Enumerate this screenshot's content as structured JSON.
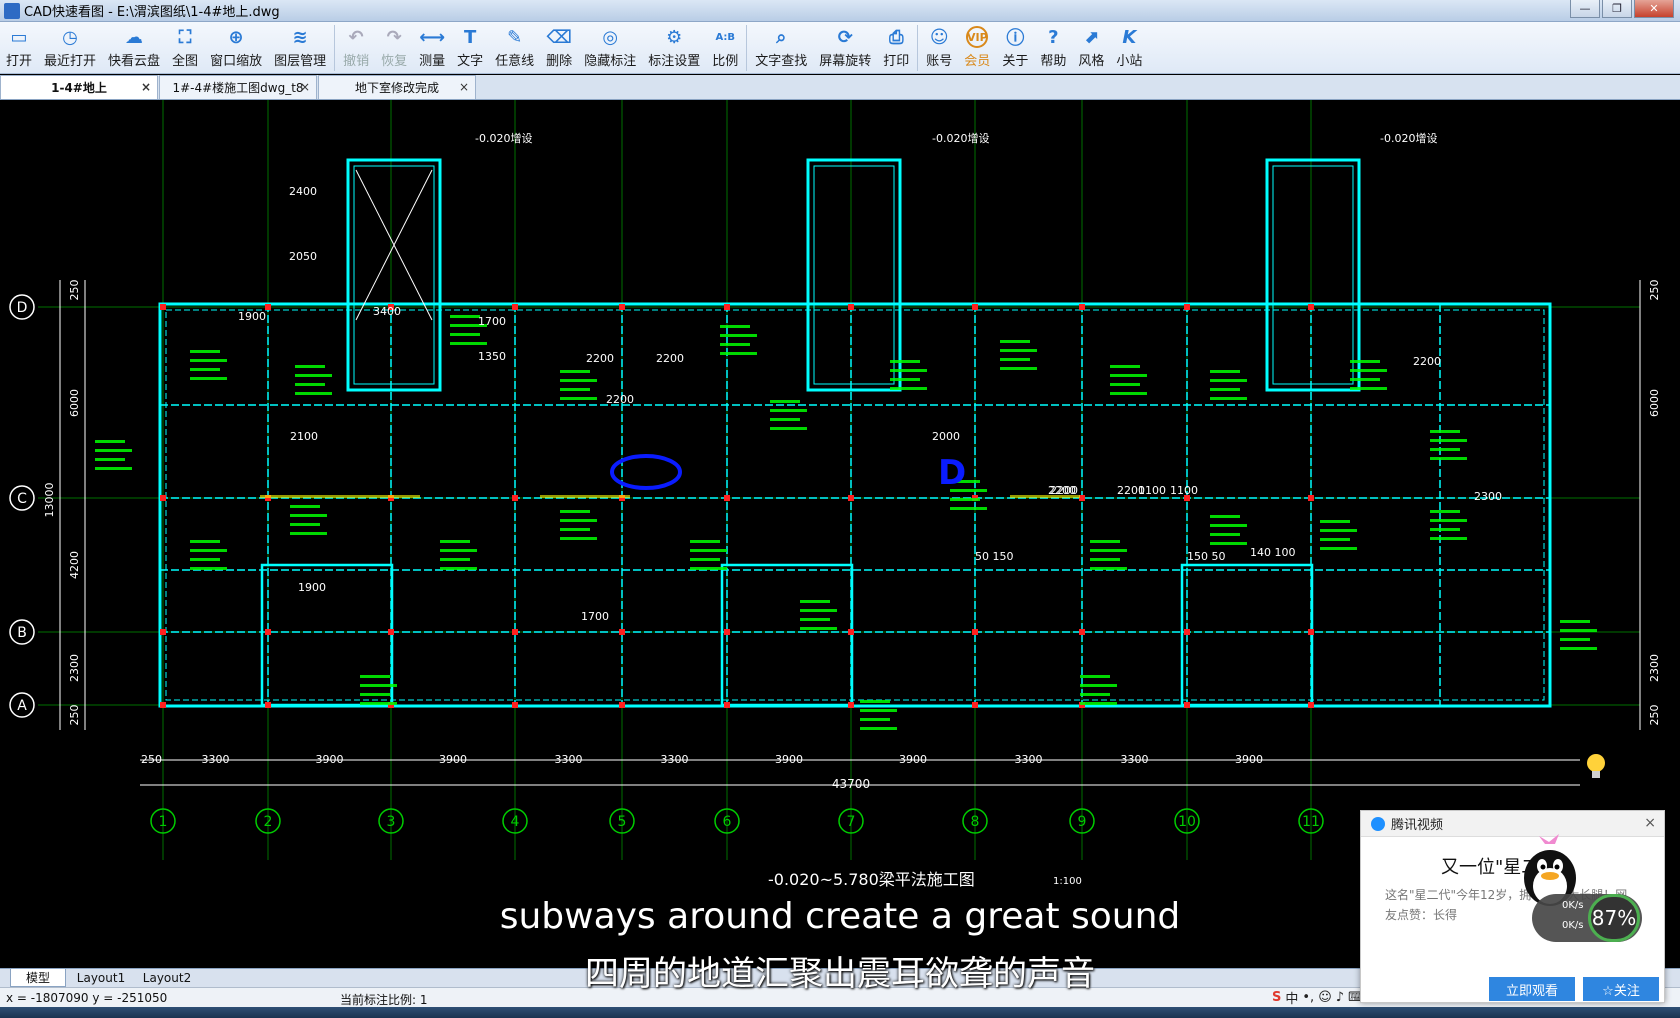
{
  "window": {
    "title": "CAD快速看图 - E:\\渭滨图纸\\1-4#地上.dwg",
    "buttons": [
      "—",
      "❐",
      "✕"
    ]
  },
  "toolbar": {
    "items": [
      {
        "label": "打开",
        "icon": "folder-open-icon"
      },
      {
        "label": "最近打开",
        "icon": "history-icon"
      },
      {
        "label": "快看云盘",
        "icon": "cloud-icon"
      },
      {
        "label": "全图",
        "icon": "fit-all-icon"
      },
      {
        "label": "窗口缩放",
        "icon": "zoom-window-icon"
      },
      {
        "label": "图层管理",
        "icon": "layers-icon"
      },
      {
        "label": "撤销",
        "icon": "undo-icon"
      },
      {
        "label": "恢复",
        "icon": "redo-icon"
      },
      {
        "label": "测量",
        "icon": "measure-icon"
      },
      {
        "label": "文字",
        "icon": "text-icon"
      },
      {
        "label": "任意线",
        "icon": "pen-icon"
      },
      {
        "label": "删除",
        "icon": "eraser-icon"
      },
      {
        "label": "隐藏标注",
        "icon": "eye-hide-icon"
      },
      {
        "label": "标注设置",
        "icon": "annotation-settings-icon"
      },
      {
        "label": "比例",
        "icon": "scale-icon"
      },
      {
        "label": "文字查找",
        "icon": "text-search-icon"
      },
      {
        "label": "屏幕旋转",
        "icon": "rotate-screen-icon"
      },
      {
        "label": "打印",
        "icon": "print-icon"
      },
      {
        "label": "账号",
        "icon": "user-icon"
      },
      {
        "label": "会员",
        "icon": "vip-icon"
      },
      {
        "label": "关于",
        "icon": "info-icon"
      },
      {
        "label": "帮助",
        "icon": "help-icon"
      },
      {
        "label": "风格",
        "icon": "style-icon"
      },
      {
        "label": "小站",
        "icon": "site-icon"
      }
    ]
  },
  "tabs": [
    {
      "label": "1-4#地上",
      "close": "×"
    },
    {
      "label": "1#-4#楼施工图dwg_t8",
      "close": "×"
    },
    {
      "label": "地下室修改完成",
      "close": "×"
    }
  ],
  "drawing": {
    "axis_rows": [
      "D",
      "C",
      "B",
      "A"
    ],
    "axis_cols": [
      "1",
      "2",
      "3",
      "4",
      "5",
      "6",
      "7",
      "8",
      "9",
      "10",
      "11"
    ],
    "bay_dims": [
      "250",
      "3300",
      "3900",
      "3900",
      "3300",
      "3300",
      "3900",
      "3900",
      "3300",
      "3300",
      "3900"
    ],
    "total_dim": "43700",
    "left_dims": [
      "250",
      "6000",
      "4200",
      "2300",
      "250"
    ],
    "total_left": "13000",
    "right_dims": [
      "250",
      "6000",
      "2300",
      "250"
    ],
    "elev_notes": [
      "-0.020增设",
      "-0.020增设",
      "-0.020增设"
    ],
    "inner_dims": [
      "2200",
      "2200",
      "2200",
      "2200",
      "1100",
      "2200",
      "2200",
      "1100",
      "2200",
      "1900",
      "1900",
      "1700",
      "2100",
      "1350",
      "2000",
      "2300",
      "1700",
      "2400",
      "2050",
      "3400",
      "50 150",
      "150 50",
      "140 100"
    ],
    "drawing_title": "-0.020~5.780梁平法施工图",
    "drawing_scale": "1:100",
    "annotation_letter": "D"
  },
  "layout_tabs": [
    "模型",
    "Layout1",
    "Layout2"
  ],
  "status": {
    "coords": "x = -1807090  y = -251050",
    "scale": "当前标注比例: 1"
  },
  "subtitles": {
    "en": "subways around create a great sound",
    "cn": "四周的地道汇聚出震耳欲聋的声音"
  },
  "popup": {
    "app": "腾讯视频",
    "close": "×",
    "title": "又一位\"星二",
    "desc": "这名\"星二代\"今年12岁，拥有天敌大长腿！网友点赞：长得",
    "watch_btn": "立即观看",
    "follow_btn": "☆关注"
  },
  "speed": {
    "up": "0K/s",
    "down": "0K/s",
    "percent": "87%"
  },
  "tray": {
    "ime": "中"
  },
  "colors": {
    "wall": "#00ffff",
    "beam_text": "#00ff00",
    "dim": "#ffffff",
    "grid": "#00cc00",
    "accent_red": "#ff2020",
    "highlight": "#ffff00",
    "ink": "#0a1cff"
  }
}
